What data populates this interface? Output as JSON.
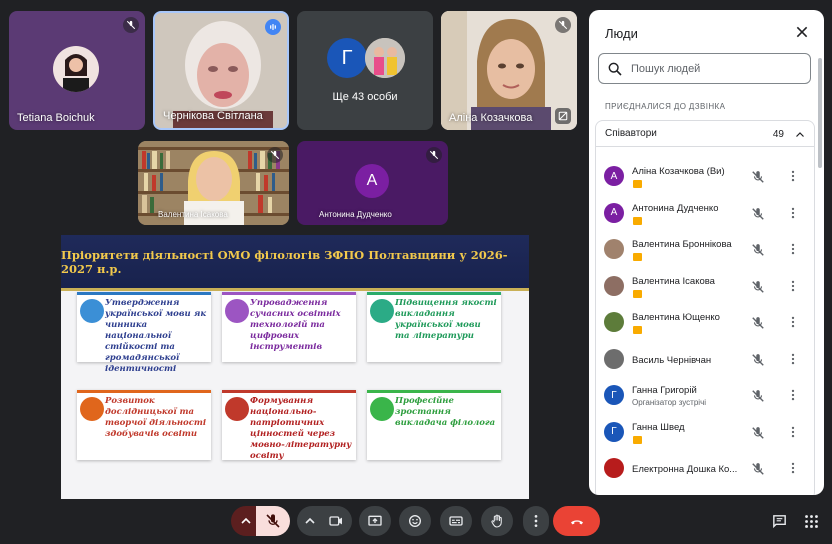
{
  "tiles": [
    {
      "name": "Tetiana Boichuk"
    },
    {
      "name": "Чернікова Світлана"
    },
    {
      "name": "Ще 43 особи",
      "avatar_letter": "Г"
    },
    {
      "name": "Аліна Козачкова"
    },
    {
      "name": "Валентина Ісакова"
    },
    {
      "name": "Антонина Дудченко",
      "avatar_letter": "А"
    }
  ],
  "slide": {
    "title": "Пріоритети діяльності ОМО філологів ЗФПО Полтавщини у 2026-2027 н.р.",
    "cards": [
      {
        "text": "Утвердження української мови як чинника національної стійкості та громадянської ідентичності",
        "color": "#2e3f8f",
        "dot": "#3b8fd6",
        "border": "#2b78c2"
      },
      {
        "text": "Упровадження сучасних освітніх технологій та цифрових інструментів",
        "color": "#7b2b9e",
        "dot": "#9c55c2",
        "border": "#9c55c2"
      },
      {
        "text": "Підвищення якості викладання української мови та літератури",
        "color": "#1f9a5a",
        "dot": "#2bab86",
        "border": "#2bab6a"
      },
      {
        "text": "Розвиток дослідницької та творчої діяльності здобувачів освіти",
        "color": "#c0392b",
        "dot": "#e0661c",
        "border": "#e0661c"
      },
      {
        "text": "Формування національно-патріотичних цінностей через мовно-літературну освіту",
        "color": "#b22222",
        "dot": "#c0392b",
        "border": "#c0392b"
      },
      {
        "text": "Професійне зростання викладача філолога",
        "color": "#2e9e3e",
        "dot": "#3ab54a",
        "border": "#3ab54a"
      }
    ]
  },
  "panel": {
    "title": "Люди",
    "search_placeholder": "Пошук людей",
    "section_label": "ПРИЄДНАЛИСЯ ДО ДЗВІНКА",
    "group_label": "Співавтори",
    "group_count": "49",
    "people": [
      {
        "name": "Аліна Козачкова (Ви)",
        "letter": "А",
        "color": "#7b1fa2"
      },
      {
        "name": "Антонина Дудченко",
        "letter": "А",
        "color": "#7b1fa2"
      },
      {
        "name": "Валентина Броннікова",
        "letter": "",
        "color": "#a0826d"
      },
      {
        "name": "Валентина Ісакова",
        "letter": "",
        "color": "#8d6e63"
      },
      {
        "name": "Валентина Ющенко",
        "letter": "",
        "color": "#5d7c3a"
      },
      {
        "name": "Василь Чернівчан",
        "letter": "",
        "color": "#6d6d6d"
      },
      {
        "name": "Ганна Григорій",
        "sub": "Організатор зустрічі",
        "letter": "Г",
        "color": "#1a56b8"
      },
      {
        "name": "Ганна Швед",
        "letter": "Г",
        "color": "#1a56b8"
      },
      {
        "name": "Електронна Дошка Ко...",
        "letter": "",
        "color": "#b71c1c"
      }
    ]
  },
  "colors": {
    "accent_red": "#ea4335",
    "dark_bg": "#202124",
    "tile_purple": "#4a2c6b"
  }
}
